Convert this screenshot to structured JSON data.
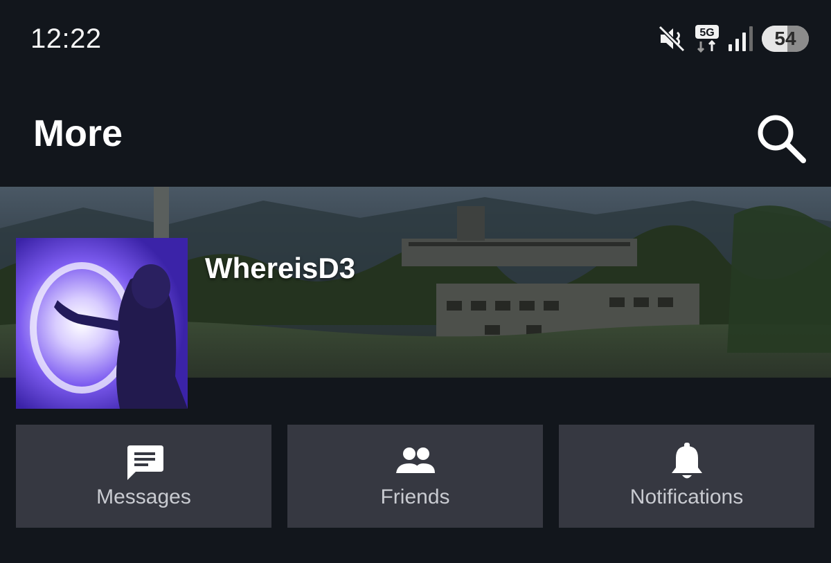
{
  "status_bar": {
    "time": "12:22",
    "battery_level": "54",
    "network_label": "5G",
    "icons": [
      "mute-icon",
      "5g-data-icon",
      "signal-icon",
      "battery-icon"
    ]
  },
  "header": {
    "title": "More",
    "search_icon": "search-icon"
  },
  "profile": {
    "username": "WhereisD3"
  },
  "actions": [
    {
      "label": "Messages",
      "icon": "message-icon"
    },
    {
      "label": "Friends",
      "icon": "friends-icon"
    },
    {
      "label": "Notifications",
      "icon": "bell-icon"
    }
  ],
  "colors": {
    "background": "#12161c",
    "card": "#363841",
    "card_text": "#c9cbd1",
    "avatar_accent": "#4632b8"
  }
}
